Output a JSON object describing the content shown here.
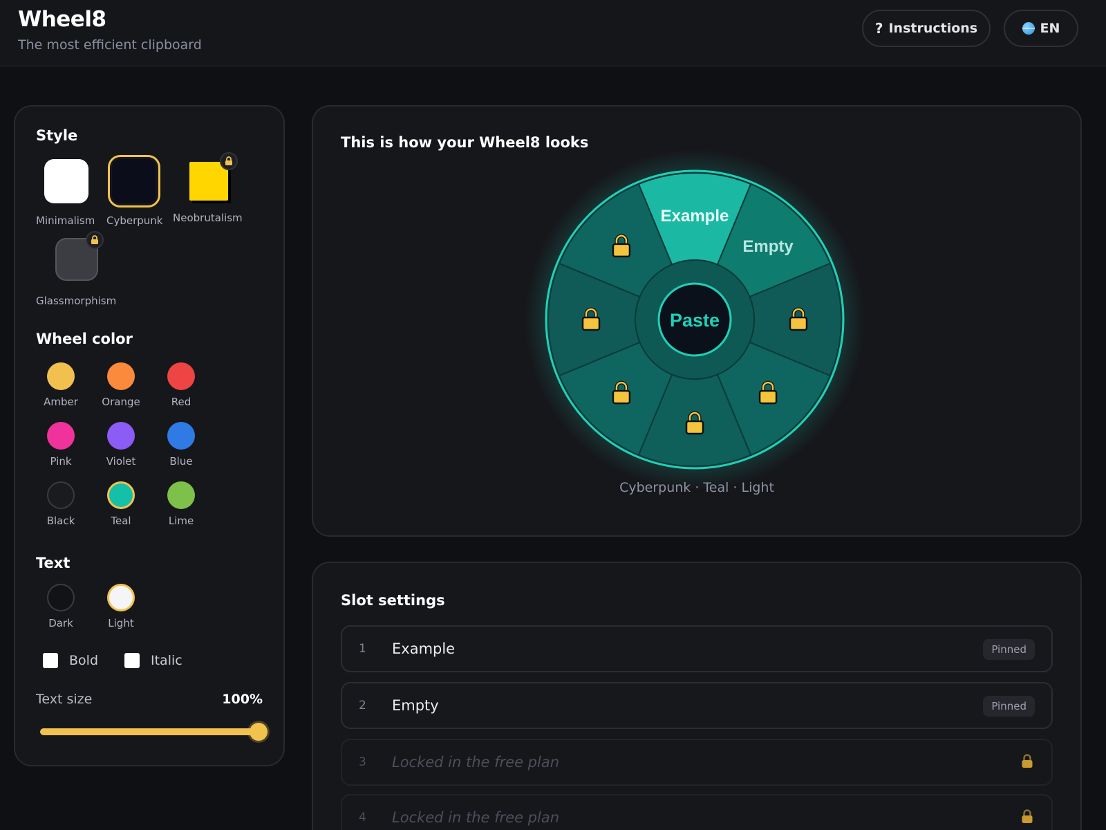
{
  "header": {
    "title": "Wheel8",
    "subtitle": "The most efficient clipboard",
    "instructions_label": "Instructions",
    "instructions_icon": "question-mark-icon",
    "lang_label": "EN",
    "lang_icon": "globe-icon"
  },
  "style": {
    "title": "Style",
    "options": [
      {
        "label": "Minimalism",
        "locked": false,
        "selected": false,
        "color": "#ffffff"
      },
      {
        "label": "Cyberpunk",
        "locked": false,
        "selected": true,
        "color": "#0b0e1a"
      },
      {
        "label": "Neobrutalism",
        "locked": true,
        "selected": false,
        "color": "#ffd600"
      },
      {
        "label": "Glassmorphism",
        "locked": true,
        "selected": false,
        "color": "#3c3d42"
      }
    ]
  },
  "wheel_color": {
    "title": "Wheel color",
    "options": [
      {
        "label": "Amber",
        "color": "#f2c04f",
        "selected": false
      },
      {
        "label": "Orange",
        "color": "#fb8a3c",
        "selected": false
      },
      {
        "label": "Red",
        "color": "#ef4444",
        "selected": false
      },
      {
        "label": "Pink",
        "color": "#f0339c",
        "selected": false
      },
      {
        "label": "Violet",
        "color": "#8b5cf6",
        "selected": false
      },
      {
        "label": "Blue",
        "color": "#2f7ae5",
        "selected": false
      },
      {
        "label": "Black",
        "color": "#1a1b1f",
        "selected": false
      },
      {
        "label": "Teal",
        "color": "#16c0a8",
        "selected": true
      },
      {
        "label": "Lime",
        "color": "#7dc04a",
        "selected": false
      }
    ]
  },
  "text_settings": {
    "title": "Text",
    "options": [
      {
        "label": "Dark",
        "color": "#121316",
        "selected": false
      },
      {
        "label": "Light",
        "color": "#f5f5f7",
        "selected": true
      }
    ],
    "bold_label": "Bold",
    "bold_checked": false,
    "italic_label": "Italic",
    "italic_checked": false,
    "size_label": "Text size",
    "size_value": "100%",
    "size_fraction": 1.0
  },
  "preview": {
    "title": "This is how your Wheel8 looks",
    "center_label": "Paste",
    "slots": [
      "Example",
      "Empty",
      "locked",
      "locked",
      "locked",
      "locked",
      "locked",
      "locked"
    ],
    "caption": "Cyberpunk · Teal · Light",
    "accent": "#1fd1b8"
  },
  "slot_settings": {
    "title": "Slot settings",
    "rows": [
      {
        "num": "1",
        "text": "Example",
        "badge": "Pinned",
        "locked": false
      },
      {
        "num": "2",
        "text": "Empty",
        "badge": "Pinned",
        "locked": false
      },
      {
        "num": "3",
        "text": "Locked in the free plan",
        "badge": "",
        "locked": true
      },
      {
        "num": "4",
        "text": "Locked in the free plan",
        "badge": "",
        "locked": true
      }
    ]
  }
}
